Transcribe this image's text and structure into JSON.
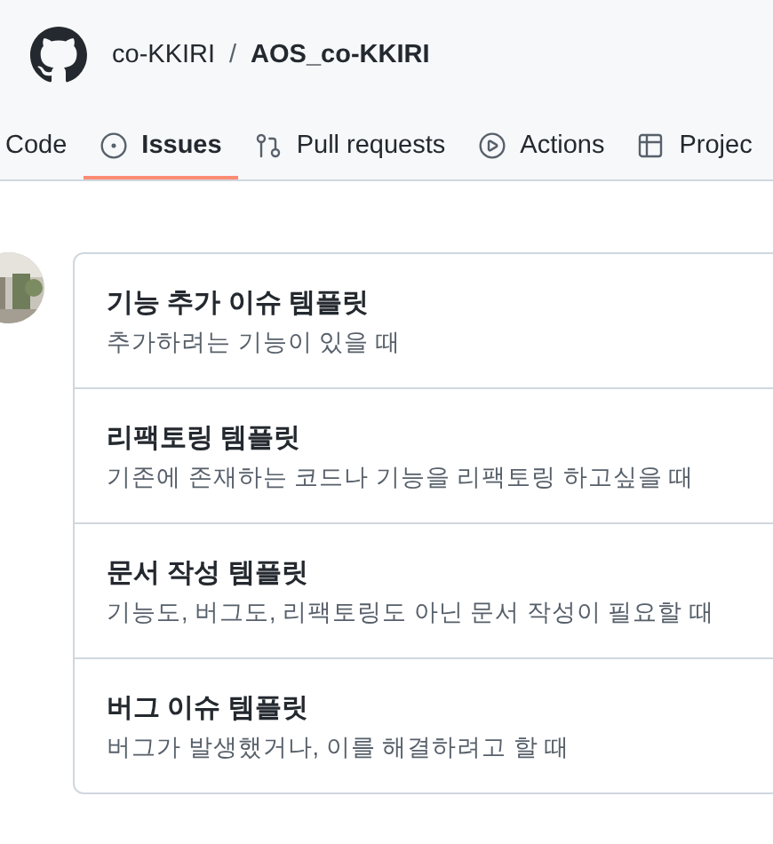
{
  "breadcrumb": {
    "owner": "co-KKIRI",
    "separator": "/",
    "repo": "AOS_co-KKIRI"
  },
  "tabs": [
    {
      "label": "Code",
      "kind": "code",
      "selected": false
    },
    {
      "label": "Issues",
      "kind": "issues",
      "selected": true
    },
    {
      "label": "Pull requests",
      "kind": "pulls",
      "selected": false
    },
    {
      "label": "Actions",
      "kind": "actions",
      "selected": false
    },
    {
      "label": "Projec",
      "kind": "projects",
      "selected": false
    }
  ],
  "templates": [
    {
      "title": "기능 추가 이슈 템플릿",
      "description": "추가하려는 기능이 있을 때"
    },
    {
      "title": "리팩토링 템플릿",
      "description": "기존에 존재하는 코드나 기능을 리팩토링 하고싶을 때"
    },
    {
      "title": "문서 작성 템플릿",
      "description": "기능도, 버그도, 리팩토링도 아닌 문서 작성이 필요할 때"
    },
    {
      "title": "버그 이슈 템플릿",
      "description": "버그가 발생했거나, 이를 해결하려고 할 때"
    }
  ]
}
